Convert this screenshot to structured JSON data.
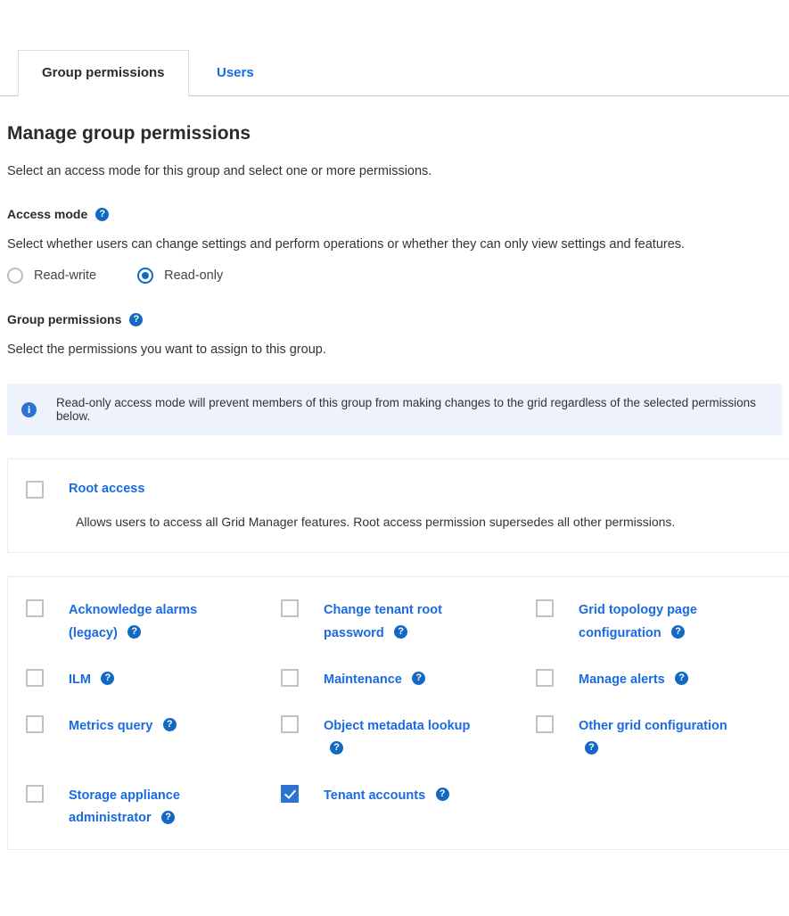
{
  "tabs": [
    {
      "label": "Group permissions",
      "active": true
    },
    {
      "label": "Users",
      "active": false
    }
  ],
  "page": {
    "title": "Manage group permissions",
    "intro": "Select an access mode for this group and select one or more permissions."
  },
  "access_mode": {
    "label": "Access mode",
    "help_icon": "help-icon",
    "description": "Select whether users can change settings and perform operations or whether they can only view settings and features.",
    "options": [
      {
        "label": "Read-write",
        "selected": false
      },
      {
        "label": "Read-only",
        "selected": true
      }
    ]
  },
  "group_permissions": {
    "label": "Group permissions",
    "help_icon": "help-icon",
    "description": "Select the permissions you want to assign to this group.",
    "banner": {
      "icon": "info-icon",
      "text": "Read-only access mode will prevent members of this group from making changes to the grid regardless of the selected permissions below."
    },
    "root": {
      "label": "Root access",
      "checked": false,
      "description": "Allows users to access all Grid Manager features. Root access permission supersedes all other permissions."
    },
    "items": [
      {
        "label": "Acknowledge alarms (legacy)",
        "checked": false,
        "help_icon": "help-icon"
      },
      {
        "label": "Change tenant root password",
        "checked": false,
        "help_icon": "help-icon"
      },
      {
        "label": "Grid topology page configuration",
        "checked": false,
        "help_icon": "help-icon"
      },
      {
        "label": "ILM",
        "checked": false,
        "help_icon": "help-icon"
      },
      {
        "label": "Maintenance",
        "checked": false,
        "help_icon": "help-icon"
      },
      {
        "label": "Manage alerts",
        "checked": false,
        "help_icon": "help-icon"
      },
      {
        "label": "Metrics query",
        "checked": false,
        "help_icon": "help-icon"
      },
      {
        "label": "Object metadata lookup",
        "checked": false,
        "help_icon": "help-icon"
      },
      {
        "label": "Other grid configuration",
        "checked": false,
        "help_icon": "help-icon"
      },
      {
        "label": "Storage appliance administrator",
        "checked": false,
        "help_icon": "help-icon"
      },
      {
        "label": "Tenant accounts",
        "checked": true,
        "help_icon": "help-icon"
      }
    ]
  },
  "icons": {
    "help_glyph": "?",
    "info_glyph": "i"
  },
  "colors": {
    "link": "#1a6ae0",
    "accent": "#2c72d2",
    "banner_bg": "#eef2fd",
    "border": "#ececec"
  }
}
